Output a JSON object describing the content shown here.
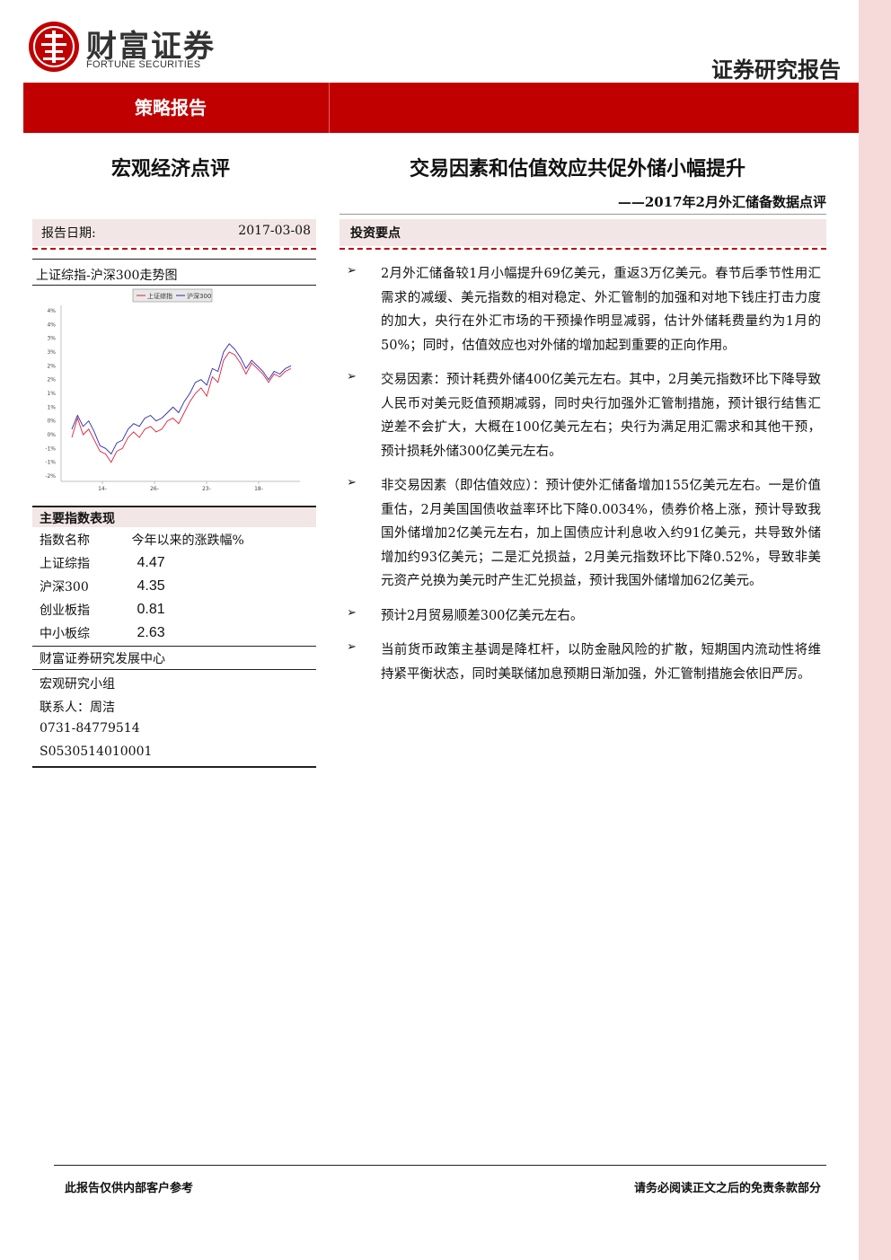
{
  "header": {
    "brand_cn": "财富证券",
    "brand_en": "FORTUNE SECURITIES",
    "doc_type": "证券研究报告",
    "report_type": "策略报告",
    "brand_color": "#c00000"
  },
  "left_title": "宏观经济点评",
  "main_title": "交易因素和估值效应共促外储小幅提升",
  "subtitle": "——2017年2月外汇储备数据点评",
  "report_date": {
    "label": "报告日期:",
    "value": "2017-03-08"
  },
  "chart": {
    "title": "上证综指-沪深300走势图"
  },
  "chart_data": {
    "type": "line",
    "legend": [
      "上证综指",
      "沪深300"
    ],
    "legend_position": "top",
    "ylim": [
      -2,
      4
    ],
    "y_ticks": [
      "4%",
      "4%",
      "3%",
      "3%",
      "2%",
      "2%",
      "1%",
      "1%",
      "0%",
      "0%",
      "-1%",
      "-1%",
      "-2%"
    ],
    "x_ticks": [
      "14-",
      "26-",
      "23-",
      "18-"
    ],
    "x": [
      0,
      1,
      2,
      3,
      4,
      5,
      6,
      7,
      8,
      9,
      10,
      11,
      12,
      13,
      14,
      15,
      16,
      17,
      18,
      19,
      20,
      21,
      22,
      23,
      24,
      25,
      26,
      27,
      28,
      29,
      30,
      31,
      32,
      33,
      34,
      35,
      36,
      37,
      38,
      39
    ],
    "series": [
      {
        "name": "上证综指",
        "color": "#e0203a",
        "values": [
          -0.6,
          0.1,
          -0.5,
          -0.3,
          -0.7,
          -1.1,
          -1.2,
          -1.5,
          -1.1,
          -1.0,
          -0.6,
          -0.4,
          -0.6,
          -0.3,
          -0.2,
          -0.4,
          -0.3,
          0.0,
          0.1,
          -0.1,
          0.3,
          0.7,
          1.0,
          1.2,
          0.9,
          1.6,
          1.4,
          2.2,
          2.5,
          2.4,
          2.1,
          1.7,
          2.1,
          1.9,
          1.7,
          1.4,
          1.7,
          1.6,
          1.8,
          1.9
        ]
      },
      {
        "name": "沪深300",
        "color": "#2a2ab0",
        "values": [
          -0.3,
          0.2,
          -0.2,
          0.0,
          -0.4,
          -0.9,
          -1.0,
          -1.2,
          -0.8,
          -0.7,
          -0.3,
          -0.1,
          -0.2,
          0.1,
          0.2,
          0.0,
          0.1,
          0.3,
          0.5,
          0.3,
          0.7,
          1.0,
          1.4,
          1.5,
          1.3,
          1.9,
          1.8,
          2.5,
          2.8,
          2.6,
          2.3,
          1.9,
          2.2,
          2.0,
          1.8,
          1.5,
          1.8,
          1.7,
          1.9,
          2.0
        ]
      }
    ]
  },
  "indices": {
    "title": "主要指数表现",
    "col_name": "指数名称",
    "col_change": "今年以来的涨跌幅%",
    "rows": [
      {
        "name": "上证综指",
        "value": "4.47"
      },
      {
        "name": "沪深300",
        "value": "4.35"
      },
      {
        "name": "创业板指",
        "value": "0.81"
      },
      {
        "name": "中小板综",
        "value": "2.63"
      }
    ]
  },
  "research_center": "财富证券研究发展中心",
  "contacts": [
    "宏观研究小组",
    "联系人：周洁",
    "0731-84779514",
    "S0530514010001"
  ],
  "key_points": {
    "title": "投资要点",
    "bullets": [
      "2月外汇储备较1月小幅提升69亿美元，重返3万亿美元。春节后季节性用汇需求的减缓、美元指数的相对稳定、外汇管制的加强和对地下钱庄打击力度的加大，央行在外汇市场的干预操作明显减弱，估计外储耗费量约为1月的50%；同时，估值效应也对外储的增加起到重要的正向作用。",
      "交易因素：预计耗费外储400亿美元左右。其中，2月美元指数环比下降导致人民币对美元贬值预期减弱，同时央行加强外汇管制措施，预计银行结售汇逆差不会扩大，大概在100亿美元左右；央行为满足用汇需求和其他干预，预计损耗外储300亿美元左右。",
      "非交易因素（即估值效应）：预计使外汇储备增加155亿美元左右。一是价值重估，2月美国国债收益率环比下降0.0034%，债券价格上涨，预计导致我国外储增加2亿美元左右，加上国债应计利息收入约91亿美元，共导致外储增加约93亿美元；二是汇兑损益，2月美元指数环比下降0.52%，导致非美元资产兑换为美元时产生汇兑损益，预计我国外储增加62亿美元。",
      "预计2月贸易顺差300亿美元左右。",
      "当前货币政策主基调是降杠杆，以防金融风险的扩散，短期国内流动性将维持紧平衡状态，同时美联储加息预期日渐加强，外汇管制措施会依旧严厉。"
    ]
  },
  "footer": {
    "left": "此报告仅供内部客户参考",
    "right": "请务必阅读正文之后的免责条款部分"
  }
}
